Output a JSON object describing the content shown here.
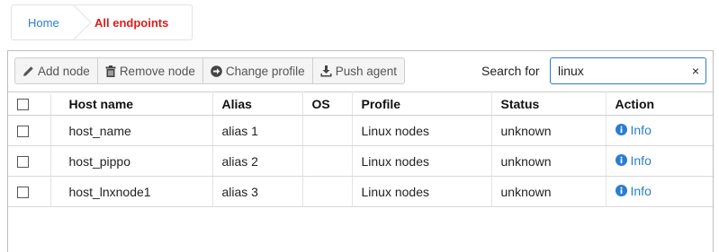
{
  "breadcrumb": {
    "home": "Home",
    "current": "All endpoints"
  },
  "toolbar": {
    "add_node": "Add node",
    "remove_node": "Remove node",
    "change_profile": "Change profile",
    "push_agent": "Push agent"
  },
  "search": {
    "label": "Search for",
    "value": "linux",
    "clear": "×"
  },
  "table": {
    "headers": {
      "host_name": "Host name",
      "alias": "Alias",
      "os": "OS",
      "profile": "Profile",
      "status": "Status",
      "action": "Action"
    },
    "rows": [
      {
        "host_name": "host_name",
        "alias": "alias 1",
        "os": "",
        "profile": "Linux nodes",
        "status": "unknown",
        "action": "Info"
      },
      {
        "host_name": "host_pippo",
        "alias": "alias 2",
        "os": "",
        "profile": "Linux nodes",
        "status": "unknown",
        "action": "Info"
      },
      {
        "host_name": "host_lnxnode1",
        "alias": "alias 3",
        "os": "",
        "profile": "Linux nodes",
        "status": "unknown",
        "action": "Info"
      }
    ]
  },
  "colors": {
    "link": "#2a7dd1",
    "breadcrumb_active": "#e01b1b",
    "search_border": "#2a7dd1"
  },
  "icons": {
    "add_node": "pencil-icon",
    "remove_node": "trash-icon",
    "change_profile": "arrow-circle-right-icon",
    "push_agent": "download-icon",
    "info": "info-circle-icon"
  }
}
